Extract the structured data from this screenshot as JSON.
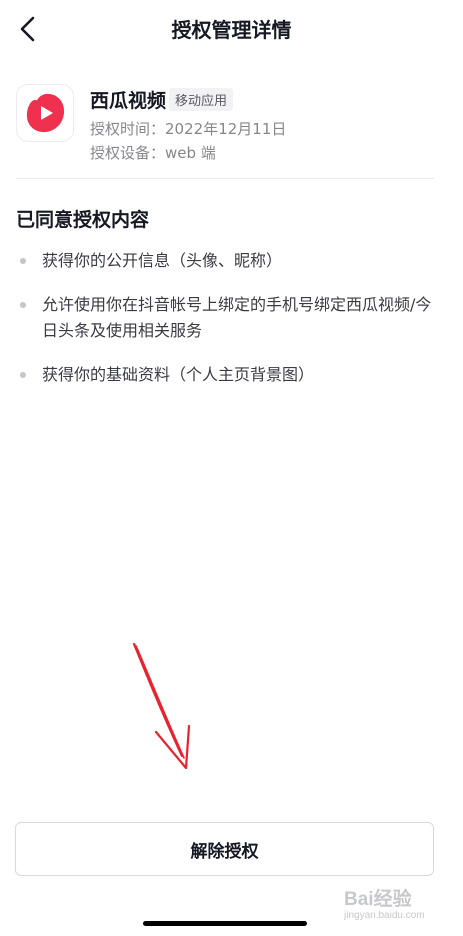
{
  "header": {
    "title": "授权管理详情",
    "back_icon": "chevron-left-icon"
  },
  "app": {
    "name": "西瓜视频",
    "tag": "移动应用",
    "auth_time_label": "授权时间：",
    "auth_time": "2022年12月11日",
    "auth_device_label": "授权设备：",
    "auth_device": "web 端",
    "icon": "xigua-video-logo",
    "brand_color": "#f0304f"
  },
  "permissions": {
    "title": "已同意授权内容",
    "items": [
      "获得你的公开信息（头像、昵称）",
      "允许使用你在抖音帐号上绑定的手机号绑定西瓜视频/今日头条及使用相关服务",
      "获得你的基础资料（个人主页背景图）"
    ]
  },
  "actions": {
    "revoke_label": "解除授权"
  },
  "annotation": {
    "arrow_color": "#e8232f"
  },
  "watermark": {
    "title": "Bai经验",
    "subtitle": "jingyan.baidu.com"
  }
}
